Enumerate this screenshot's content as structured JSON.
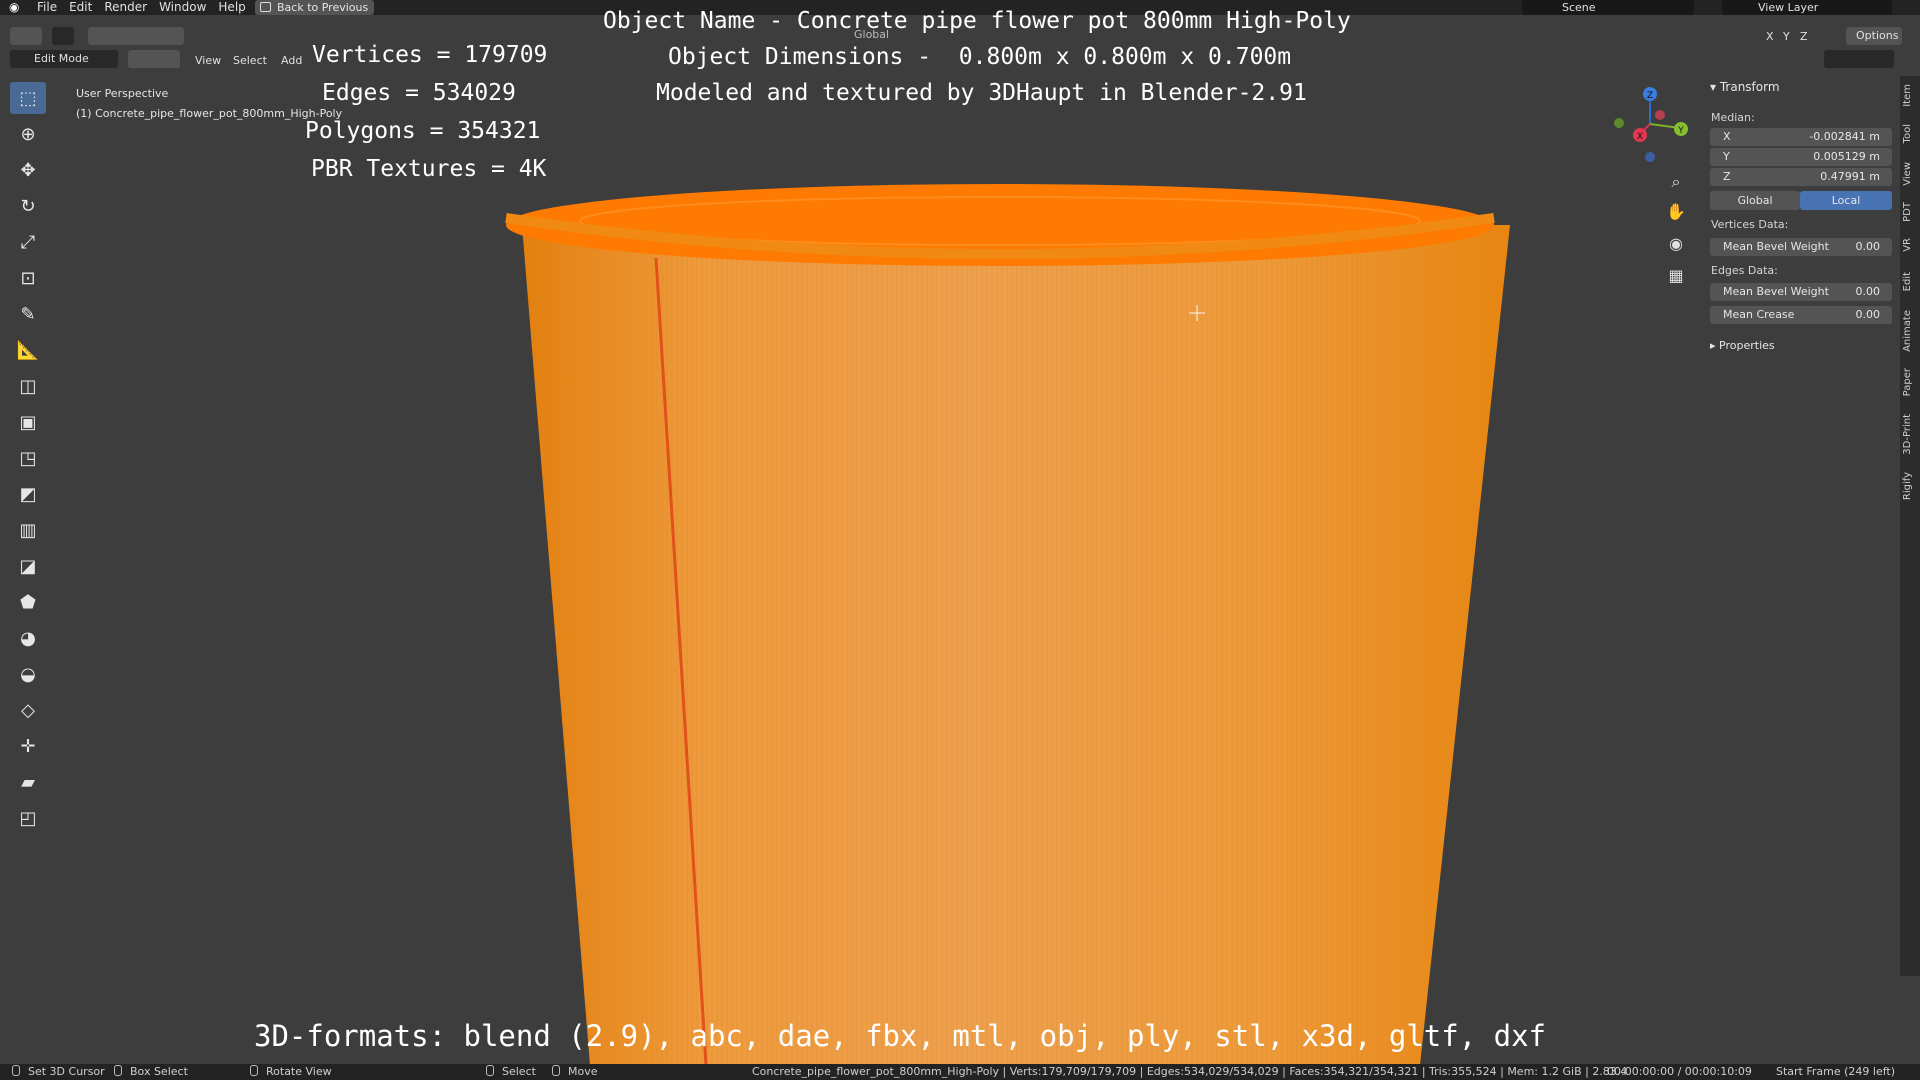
{
  "menu": {
    "items": [
      "File",
      "Edit",
      "Render",
      "Window",
      "Help"
    ],
    "back_button": "Back to Previous",
    "scene": "Scene",
    "view_layer": "View Layer"
  },
  "header": {
    "mode": "Edit Mode",
    "menus": [
      "View",
      "Select",
      "Add"
    ],
    "transform_orientation": "Global",
    "options": "Options",
    "axis_labels": [
      "X",
      "Y",
      "Z"
    ]
  },
  "viewport": {
    "perspective": "User Perspective",
    "object_label": "(1) Concrete_pipe_flower_pot_800mm_High-Poly"
  },
  "overlay": {
    "vertices": "Vertices = 179709",
    "edges": "Edges = 534029",
    "polygons": "Polygons = 354321",
    "textures": "PBR Textures = 4K",
    "object_name": "Object Name - Concrete pipe flower pot 800mm High-Poly",
    "dimensions": "Object Dimensions -  0.800m x 0.800m x 0.700m",
    "credit": "Modeled and textured by 3DHaupt in Blender-2.91",
    "formats": "3D-formats: blend (2.9), abc, dae, fbx, mtl, obj, ply, stl, x3d, gltf, dxf"
  },
  "npanel": {
    "transform_title": "Transform",
    "median_label": "Median:",
    "x_label": "X",
    "x_value": "-0.002841 m",
    "y_label": "Y",
    "y_value": "0.005129 m",
    "z_label": "Z",
    "z_value": "0.47991 m",
    "global": "Global",
    "local": "Local",
    "vertices_data": "Vertices Data:",
    "v_bevel_label": "Mean Bevel Weight",
    "v_bevel_value": "0.00",
    "edges_data": "Edges Data:",
    "e_bevel_label": "Mean Bevel Weight",
    "e_bevel_value": "0.00",
    "crease_label": "Mean Crease",
    "crease_value": "0.00",
    "properties": "Properties",
    "tabs": [
      "Item",
      "Tool",
      "View",
      "PDT",
      "VR",
      "Edit",
      "Animate",
      "Paper",
      "3D-Print",
      "Rigify"
    ]
  },
  "statusbar": {
    "set_cursor": "Set 3D Cursor",
    "box_select": "Box Select",
    "rotate_view": "Rotate View",
    "select": "Select",
    "move": "Move",
    "stats": "Concrete_pipe_flower_pot_800mm_High-Poly | Verts:179,709/179,709 | Edges:534,029/534,029 | Faces:354,321/354,321 | Tris:355,524 | Mem: 1.2 GiB | 2.83.4",
    "time": "00:00:00:00 / 00:00:10:09",
    "frame": "Start Frame (249 left)"
  },
  "colors": {
    "mesh_orange": "#f28a12",
    "mesh_top": "#ff7a00",
    "selected_edge": "#e0521a",
    "active_blue": "#4a6a96"
  }
}
